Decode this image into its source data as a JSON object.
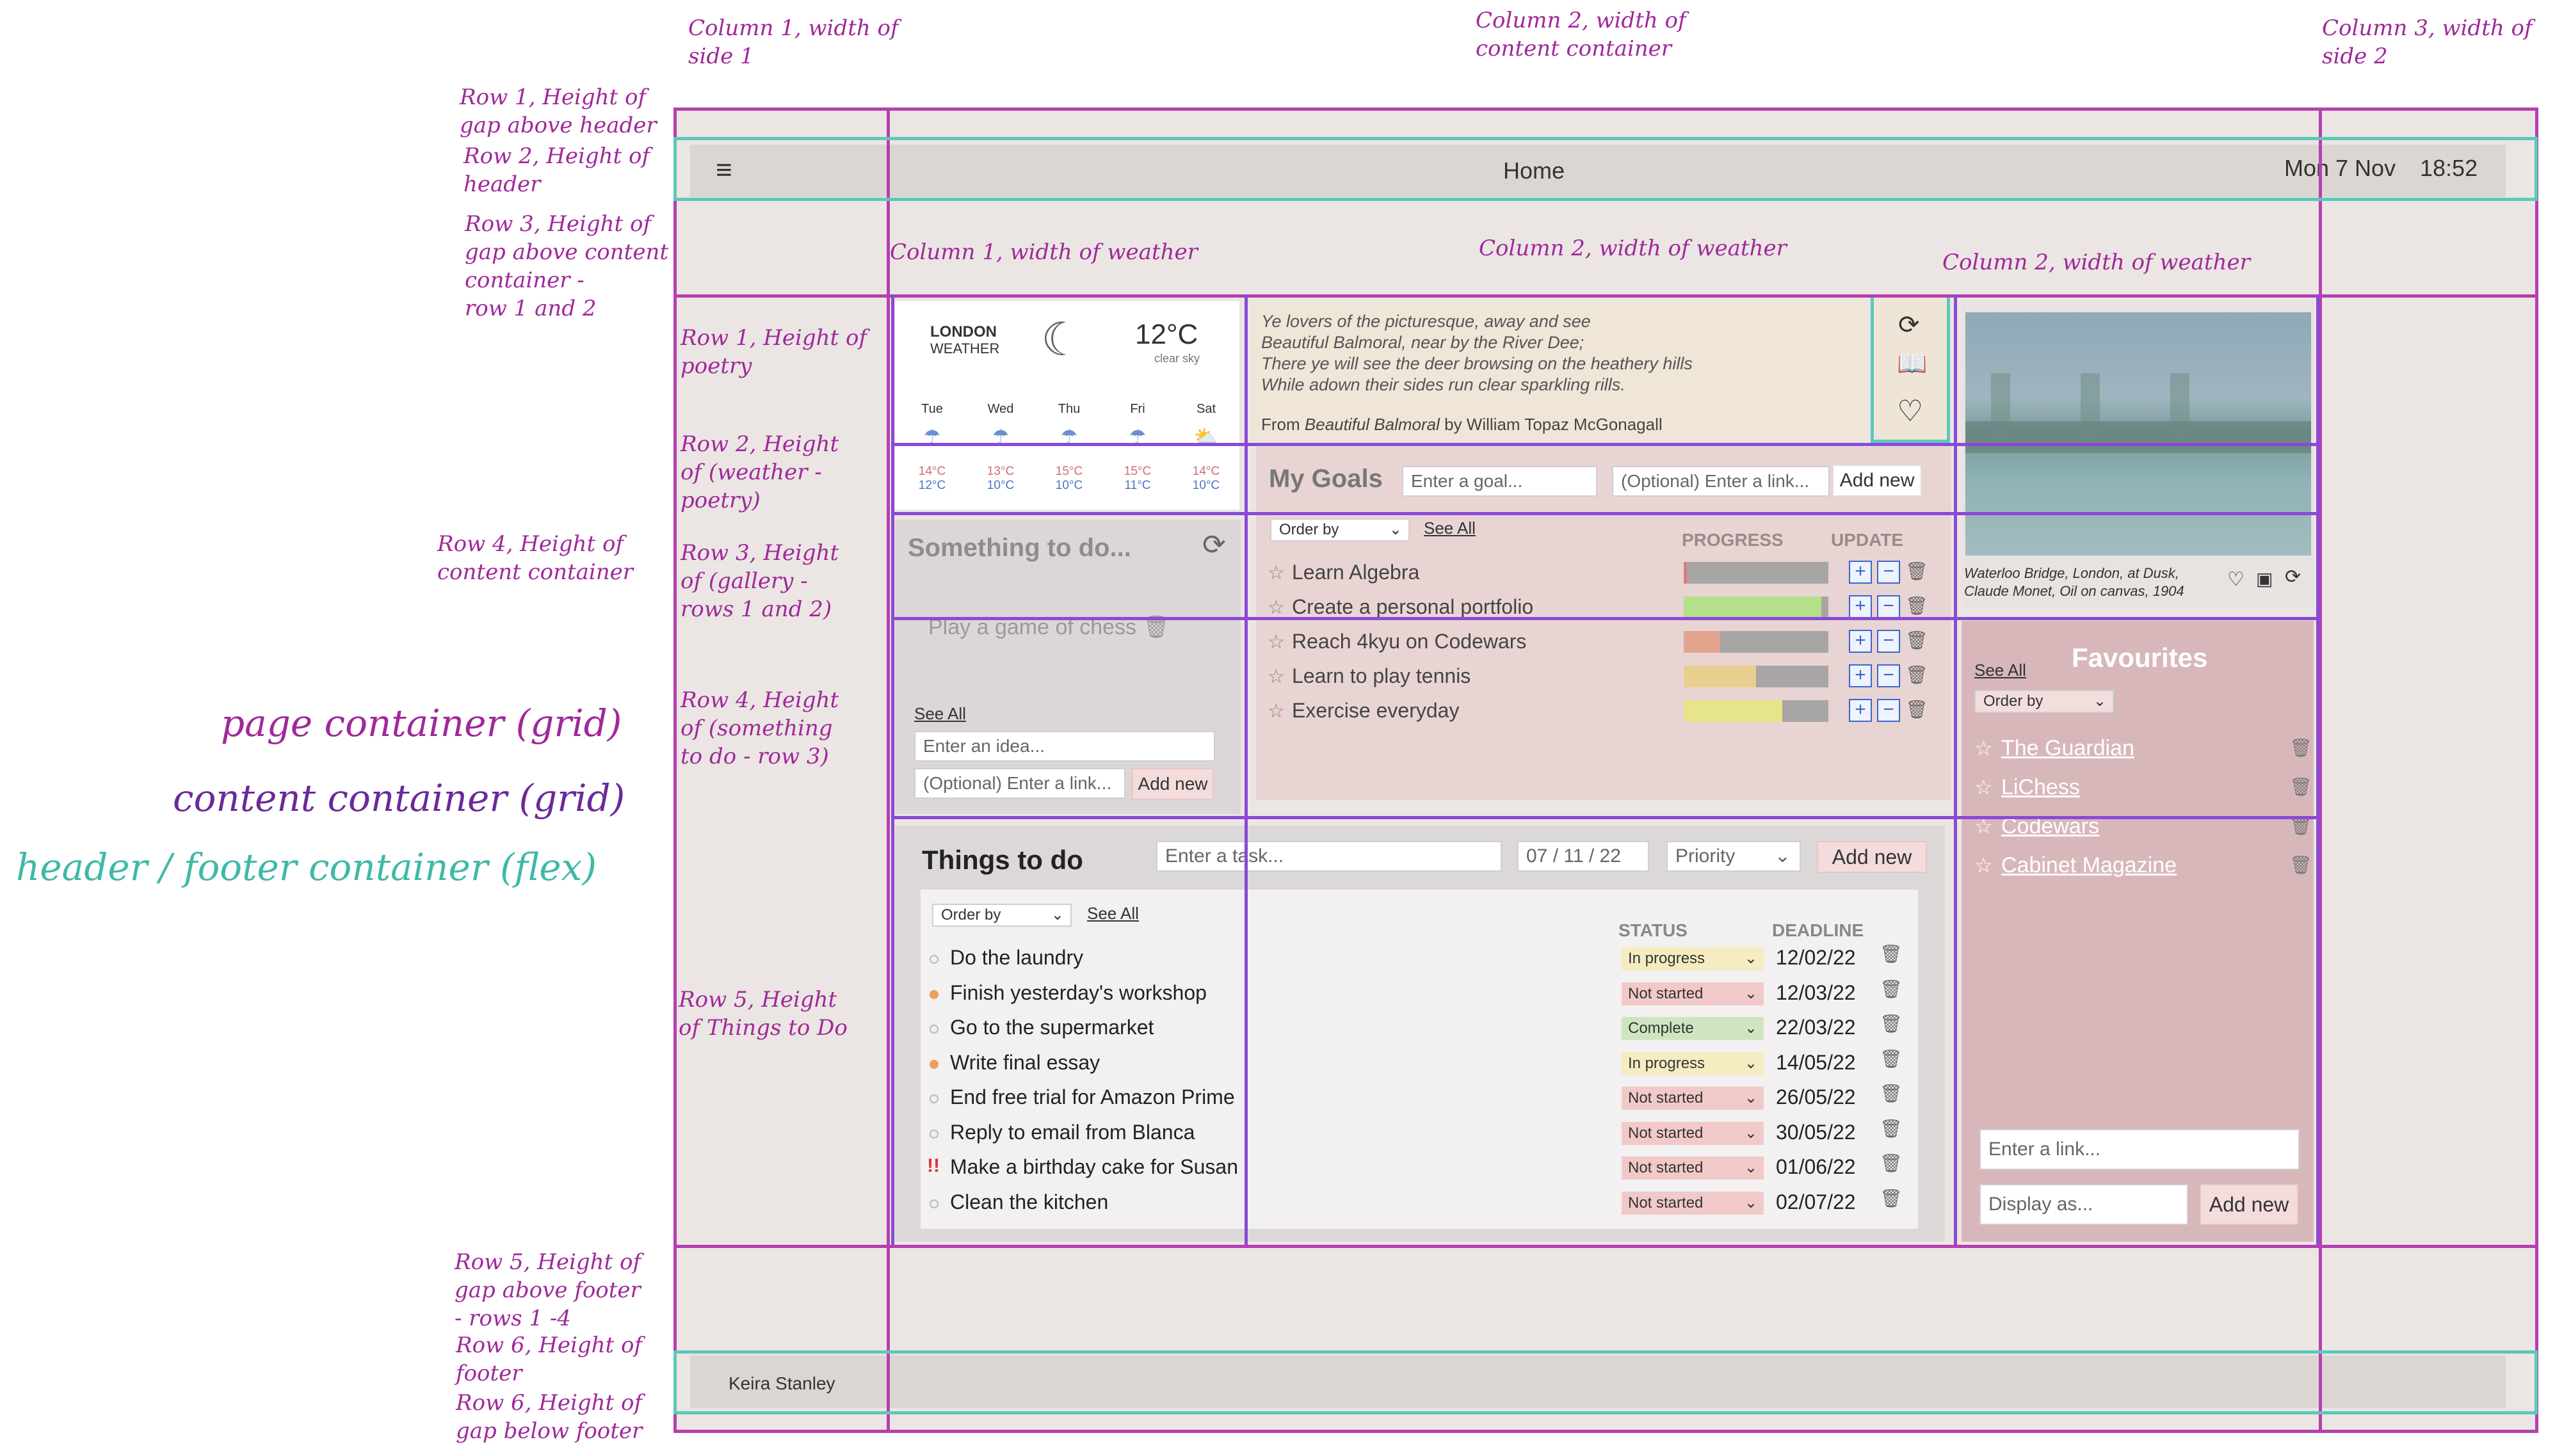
{
  "annotations": {
    "col1_side": "Column 1, width of\nside 1",
    "col2_content": "Column 2, width of\ncontent container",
    "col3_side": "Column 3, width of\nside 2",
    "row1_gap_header": "Row 1, Height of\ngap above header",
    "row2_header": "Row 2, Height of\nheader",
    "row3_gap_content": "Row 3, Height of\ngap above content\ncontainer -\nrow 1 and 2",
    "row4_content": "Row 4, Height of\ncontent container",
    "row5_gap_footer": "Row 5, Height of\ngap above footer\n- rows 1 -4",
    "row6_footer": "Row 6, Height of\nfooter",
    "row6_gap_below": "Row 6, Height of\ngap below footer",
    "weather_col1": "Column 1, width of weather",
    "weather_col2": "Column 2, width of weather",
    "weather_col3": "Column 2, width of weather",
    "inner_row1": "Row 1, Height of\npoetry",
    "inner_row2": "Row 2, Height\nof (weather -\npoetry)",
    "inner_row3": "Row 3, Height\nof (gallery -\nrows 1 and 2)",
    "inner_row4": "Row 4, Height\nof (something\nto do - row 3)",
    "inner_row5": "Row 5, Height\nof Things to Do",
    "legend_page": "page container (grid)",
    "legend_content": "content container (grid)",
    "legend_header": "header / footer container (flex)"
  },
  "header": {
    "menu_icon": "hamburger-icon",
    "title": "Home",
    "date": "Mon 7 Nov",
    "time": "18:52"
  },
  "footer": {
    "name": "Keira Stanley"
  },
  "weather": {
    "city": "LONDON",
    "label": "WEATHER",
    "temp": "12°C",
    "desc": "clear sky",
    "days": [
      {
        "day": "Tue",
        "high": "14°C",
        "low": "12°C"
      },
      {
        "day": "Wed",
        "high": "13°C",
        "low": "10°C"
      },
      {
        "day": "Thu",
        "high": "15°C",
        "low": "10°C"
      },
      {
        "day": "Fri",
        "high": "15°C",
        "low": "11°C"
      },
      {
        "day": "Sat",
        "high": "14°C",
        "low": "10°C"
      }
    ]
  },
  "poetry": {
    "lines": [
      "Ye lovers of the picturesque, away and see",
      "Beautiful Balmoral, near by the River Dee;",
      "There ye will see the deer browsing on the heathery hills",
      "While adown their sides run clear sparkling rills."
    ],
    "source_prefix": "From ",
    "source_title": "Beautiful Balmoral",
    "source_suffix": " by William Topaz McGonagall"
  },
  "gallery": {
    "caption_line1": "Waterloo Bridge, London, at Dusk,",
    "caption_line2": "Claude Monet, Oil on canvas, 1904"
  },
  "something": {
    "title": "Something to do...",
    "item": "Play a game of chess",
    "see_all": "See All",
    "idea_placeholder": "Enter an idea...",
    "link_placeholder": "(Optional) Enter a link...",
    "add": "Add new"
  },
  "goals": {
    "title": "My Goals",
    "goal_placeholder": "Enter a goal...",
    "link_placeholder": "(Optional) Enter a link...",
    "add": "Add new",
    "order": "Order by",
    "see_all": "See All",
    "progress_header": "PROGRESS",
    "update_header": "UPDATE",
    "items": [
      {
        "name": "Learn Algebra",
        "progress": 0.02,
        "color": "#e07b7b"
      },
      {
        "name": "Create a personal portfolio",
        "progress": 0.95,
        "color": "#b4e08a"
      },
      {
        "name": "Reach 4kyu on Codewars",
        "progress": 0.25,
        "color": "#e3a48e"
      },
      {
        "name": "Learn to play tennis",
        "progress": 0.5,
        "color": "#e8cf8f"
      },
      {
        "name": "Exercise everyday",
        "progress": 0.68,
        "color": "#e6e58a"
      }
    ]
  },
  "favourites": {
    "title": "Favourites",
    "see_all": "See All",
    "order": "Order by",
    "items": [
      "The Guardian",
      "LiChess",
      "Codewars",
      "Cabinet Magazine"
    ],
    "link_placeholder": "Enter a link...",
    "display_placeholder": "Display as...",
    "add": "Add new"
  },
  "todo": {
    "title": "Things to do",
    "task_placeholder": "Enter a task...",
    "date": "07 / 11 / 22",
    "priority": "Priority",
    "add": "Add new",
    "order": "Order by",
    "see_all": "See All",
    "status_header": "STATUS",
    "deadline_header": "DEADLINE",
    "items": [
      {
        "name": "Do the laundry",
        "status": "In progress",
        "deadline": "12/02/22",
        "marker": "none"
      },
      {
        "name": "Finish yesterday's workshop",
        "status": "Not started",
        "deadline": "12/03/22",
        "marker": "orange"
      },
      {
        "name": "Go to the supermarket",
        "status": "Complete",
        "deadline": "22/03/22",
        "marker": "none"
      },
      {
        "name": "Write final essay",
        "status": "In progress",
        "deadline": "14/05/22",
        "marker": "orange"
      },
      {
        "name": "End free trial for Amazon Prime",
        "status": "Not started",
        "deadline": "26/05/22",
        "marker": "none"
      },
      {
        "name": "Reply to email from Blanca",
        "status": "Not started",
        "deadline": "30/05/22",
        "marker": "none"
      },
      {
        "name": "Make a birthday cake for Susan",
        "status": "Not started",
        "deadline": "01/06/22",
        "marker": "urgent"
      },
      {
        "name": "Clean the kitchen",
        "status": "Not started",
        "deadline": "02/07/22",
        "marker": "none"
      }
    ],
    "urgent_mark": "!!"
  }
}
